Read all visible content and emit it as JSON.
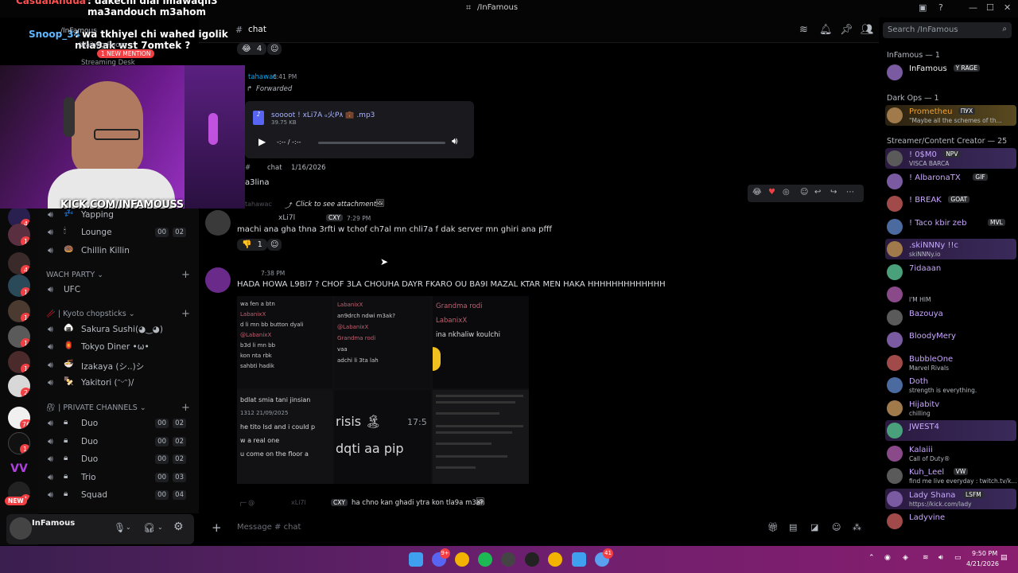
{
  "window": {
    "title": "/InFamous",
    "controls": [
      "—",
      "☐",
      "✕"
    ]
  },
  "overlay_chat": [
    {
      "user": "CasualAndua",
      "text": ": dakechi dial lmawaqil3 ma3andouch m3ahom"
    },
    {
      "user": "Snoop_34",
      "text": ": wa tkhiyel chi wahed igolik ntla9ak wst 7omtek ?"
    }
  ],
  "overlay_ui": {
    "server_name": "/InFamous",
    "waiting_room": "Waiting Room",
    "streaming_desk": "Streaming Desk",
    "new_mention": "1 NEW MENTION",
    "kick_url": "KICK.COM/INFAMOUSS"
  },
  "header": {
    "channel": "chat",
    "search_placeholder": "Search /InFamous"
  },
  "messages": {
    "top_reaction": {
      "emoji": "😂",
      "count": "4"
    },
    "forward": {
      "author": "tahawac",
      "time": "6:41 PM",
      "label": "Forwarded",
      "file_name": "soooot ! xLi7A ₒ火ᑭ٨ 💼 .mp3",
      "file_size": "39.75 KB",
      "time_display": "-:-- / -:--",
      "source_channel": "chat",
      "source_date": "1/16/2026"
    },
    "a3lina": "a3lina",
    "reply_ctx": {
      "user": "@tahawac",
      "text": "Click to see attachment"
    },
    "msg1": {
      "author": "xLi7ا",
      "tag": "CXY",
      "time": "7:29 PM",
      "text": "machi ana gha thna 3rfti w tchof ch7al mn chli7a f dak server mn ghiri ana pfff",
      "reaction_count": "1"
    },
    "msg2": {
      "time": "7:38 PM",
      "text": "HADA HOWA L9BI7 ? CHOF 3LA CHOUHA DAYR FKARO OU BA9I MAZAL KTAR MEN HAKA HHHHHHHHHHHHH"
    },
    "grid": {
      "c1": [
        "wa fen a btn",
        "LabanixX",
        "d li mn bb button dyali",
        "@LabanixX",
        "b3d li mn bb",
        "kon nta rbk",
        "sahbti hadik"
      ],
      "c2": [
        "LabanixX",
        "an9drch ndwi m3ak?",
        "@LabanixX",
        "Grandma rodi",
        "vaa",
        "adchi li 3ta lah"
      ],
      "c3": [
        "Grandma rodi",
        "LabanixX",
        "ina nkhaliw koulchi"
      ],
      "c4": [
        "bdlat smia tani jinsian",
        "1312",
        "21/09/2025",
        "he tito lsd and i could p",
        "w a real one",
        "u come on the floor a"
      ],
      "c5": [
        "risis 🏝",
        "17:5",
        "dqti aa pip"
      ]
    },
    "last": {
      "author": "xLi7ا",
      "tag": "CXY",
      "text": "ha chno kan ghadi ytra kon tla9a m3ah"
    }
  },
  "composer": {
    "placeholder": "Message # chat"
  },
  "channels": {
    "voice_top": [
      {
        "emoji": "💤",
        "label": "Yapping"
      },
      {
        "emoji": "🕯",
        "label": "Lounge",
        "counts": [
          "00",
          "02"
        ]
      },
      {
        "emoji": "🍩",
        "label": "Chillin Killin"
      }
    ],
    "cat_wach": "WACH PARTY",
    "ufc": "UFC",
    "cat_kyoto": "| Kyoto chopsticks",
    "kyoto": [
      {
        "emoji": "🍙",
        "label": "Sakura Sushi(◕‿◕)"
      },
      {
        "emoji": "🏮",
        "label": "Tokyo Diner •ω•"
      },
      {
        "emoji": "🍜",
        "label": "Izakaya (シ..)シ"
      },
      {
        "emoji": "🍢",
        "label": "Yakitori (ᵔᵕᵔ)/"
      }
    ],
    "cat_private": "| PRIVATE CHANNELS",
    "private": [
      {
        "label": "Duo",
        "counts": [
          "00",
          "02"
        ]
      },
      {
        "label": "Duo",
        "counts": [
          "00",
          "02"
        ]
      },
      {
        "label": "Duo",
        "counts": [
          "00",
          "02"
        ]
      },
      {
        "label": "Trio",
        "counts": [
          "00",
          "03"
        ]
      },
      {
        "label": "Squad",
        "counts": [
          "00",
          "04"
        ]
      }
    ]
  },
  "user_panel": {
    "name": "InFamous"
  },
  "server_badges": [
    "4",
    "1",
    "4",
    "1",
    "1",
    "1",
    "1",
    "2",
    "76",
    "1",
    "1"
  ],
  "new_badge": "NEW",
  "members": {
    "groups": [
      {
        "title": "InFamous — 1",
        "members": [
          {
            "name": "InFamous",
            "tag": "Y RAGE"
          }
        ]
      },
      {
        "title": "Dark Ops — 1",
        "members": [
          {
            "name": "Prometheu",
            "tag": "ПУX",
            "status": "\"Maybe all the schemes of th..."
          }
        ]
      },
      {
        "title": "Streamer/Content Creator — 25",
        "members": [
          {
            "name": "! 0$M0",
            "tag": "NPV",
            "status": "VISCA BARCA"
          },
          {
            "name": "! AlbaronaTX",
            "tag": "GIF"
          },
          {
            "name": "! BREAK",
            "tag": "GOAT"
          },
          {
            "name": "! Taco kbir zeb",
            "tag": "MVL"
          },
          {
            "name": ".skiNNNy !!c",
            "status": "skiNNNy.io"
          },
          {
            "name": "7idaaan"
          },
          {
            "name": "",
            "status": "I'M HIM"
          },
          {
            "name": "Bazouya"
          },
          {
            "name": "BloodyMery"
          },
          {
            "name": "BubbleOne",
            "status": "Marvel Rivals"
          },
          {
            "name": "Doth",
            "status": "strength is everything."
          },
          {
            "name": "Hijabitv",
            "status": "chilling"
          },
          {
            "name": "JWEST4"
          },
          {
            "name": "Kalaiii",
            "status": "Call of Duty®"
          },
          {
            "name": "Kuh_Leel",
            "tag": "VW",
            "status": "find me live everyday : twitch.tv/k..."
          },
          {
            "name": "Lady Shana",
            "tag": "LSFM",
            "status": "https://kick.com/lady"
          },
          {
            "name": "Ladyvine"
          }
        ]
      }
    ]
  },
  "taskbar": {
    "time": "9:50 PM",
    "date": "4/21/2026",
    "badge_discord": "9+",
    "badge_other": "41"
  },
  "colors": {
    "accent": "#5865f2",
    "mention_red": "#f23f43",
    "member_name": "#c9a7ff",
    "taskbar": "#6b1f6e"
  }
}
